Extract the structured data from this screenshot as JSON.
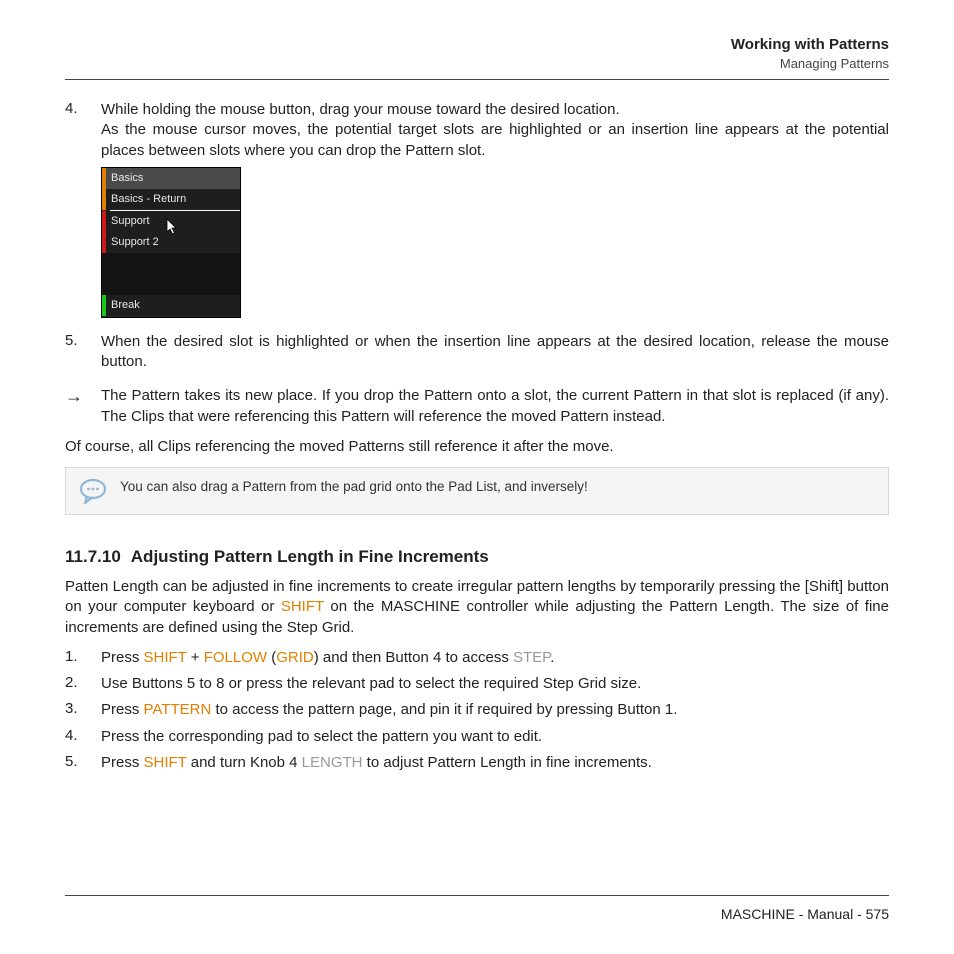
{
  "header": {
    "title": "Working with Patterns",
    "subtitle": "Managing Patterns"
  },
  "step4": {
    "num": "4.",
    "line1": "While holding the mouse button, drag your mouse toward the desired location.",
    "line2": "As the mouse cursor moves, the potential target slots are highlighted or an insertion line appears at the potential places between slots where you can drop the Pattern slot."
  },
  "screenshot": {
    "slots": [
      "Basics",
      "Basics - Return",
      "Support",
      "Support 2",
      "Break"
    ]
  },
  "step5": {
    "num": "5.",
    "text": "When the desired slot is highlighted or when the insertion line appears at the desired location, release the mouse button."
  },
  "result": {
    "arrow": "→",
    "text": "The Pattern takes its new place. If you drop the Pattern onto a slot, the current Pattern in that slot is replaced (if any). The Clips that were referencing this Pattern will reference the moved Pattern instead."
  },
  "para_after": "Of course, all Clips referencing the moved Patterns still reference it after the move.",
  "tip": "You can also drag a Pattern from the pad grid onto the Pad List, and inversely!",
  "section": {
    "number": "11.7.10",
    "title": "Adjusting Pattern Length in Fine Increments"
  },
  "section_intro": {
    "a": "Patten Length can be adjusted in fine increments to create irregular pattern lengths by temporarily pressing the [Shift] button on your computer keyboard or ",
    "shift": "SHIFT",
    "b": " on the MASCHINE controller while adjusting the Pattern Length. The size of fine increments are defined using the Step Grid."
  },
  "s1": {
    "num": "1.",
    "a": "Press ",
    "shift": "SHIFT",
    "plus": " + ",
    "follow": "FOLLOW",
    "paren_open": " (",
    "grid": "GRID",
    "b": ") and then Button 4 to access ",
    "step": "STEP",
    "end": "."
  },
  "s2": {
    "num": "2.",
    "text": "Use Buttons 5 to 8 or press the relevant pad to select the required Step Grid size."
  },
  "s3": {
    "num": "3.",
    "a": "Press ",
    "pattern": "PATTERN",
    "b": " to access the pattern page, and pin it if required by pressing Button 1."
  },
  "s4": {
    "num": "4.",
    "text": "Press the corresponding pad to select the pattern you want to edit."
  },
  "s5": {
    "num": "5.",
    "a": "Press ",
    "shift": "SHIFT",
    "b": " and turn Knob 4 ",
    "length": "LENGTH",
    "c": " to adjust Pattern Length in fine increments."
  },
  "footer": {
    "product": "MASCHINE",
    "doc": "Manual",
    "page": "575"
  }
}
